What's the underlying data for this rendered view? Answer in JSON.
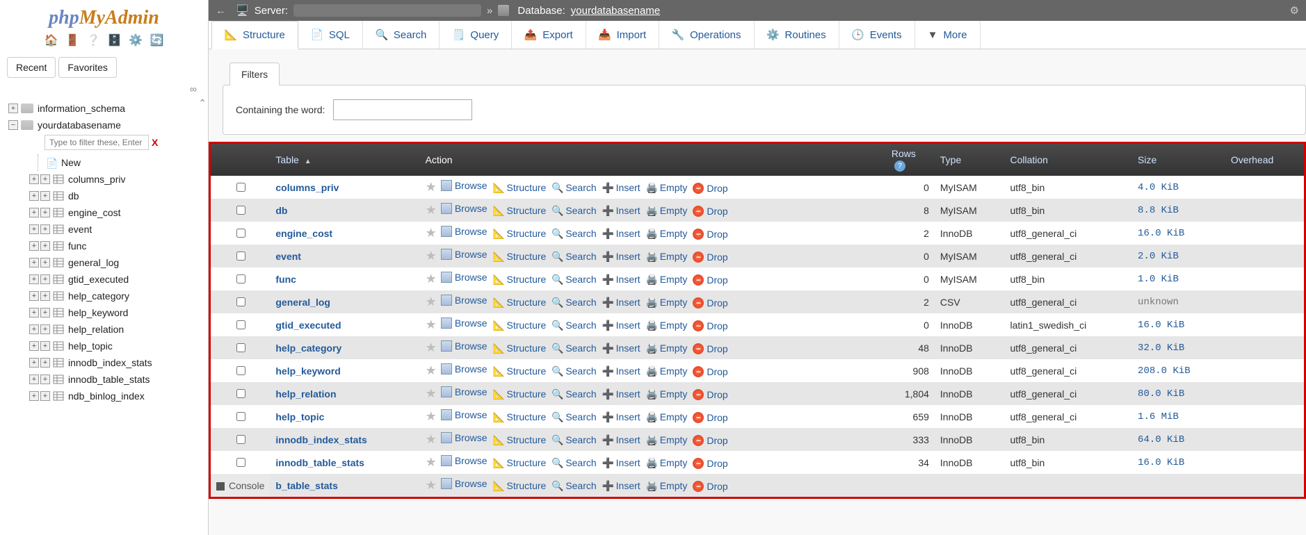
{
  "logo": {
    "part1": "php",
    "part2": "MyAdmin"
  },
  "sidebar_tabs": {
    "recent": "Recent",
    "favorites": "Favorites"
  },
  "link_symbol": "∞",
  "tree": {
    "db1": "information_schema",
    "db2": "yourdatabasename",
    "filter_placeholder": "Type to filter these, Enter to se",
    "new_label": "New",
    "tables": [
      "columns_priv",
      "db",
      "engine_cost",
      "event",
      "func",
      "general_log",
      "gtid_executed",
      "help_category",
      "help_keyword",
      "help_relation",
      "help_topic",
      "innodb_index_stats",
      "innodb_table_stats",
      "ndb_binlog_index"
    ]
  },
  "breadcrumb": {
    "server_label": "Server:",
    "database_label": "Database:",
    "database_name": "yourdatabasename"
  },
  "topmenu": [
    {
      "key": "structure",
      "label": "Structure"
    },
    {
      "key": "sql",
      "label": "SQL"
    },
    {
      "key": "search",
      "label": "Search"
    },
    {
      "key": "query",
      "label": "Query"
    },
    {
      "key": "export",
      "label": "Export"
    },
    {
      "key": "import",
      "label": "Import"
    },
    {
      "key": "operations",
      "label": "Operations"
    },
    {
      "key": "routines",
      "label": "Routines"
    },
    {
      "key": "events",
      "label": "Events"
    },
    {
      "key": "more",
      "label": "More"
    }
  ],
  "filters": {
    "title": "Filters",
    "containing_label": "Containing the word:"
  },
  "headers": {
    "table": "Table",
    "action": "Action",
    "rows": "Rows",
    "type": "Type",
    "collation": "Collation",
    "size": "Size",
    "overhead": "Overhead"
  },
  "actions": {
    "browse": "Browse",
    "structure": "Structure",
    "search": "Search",
    "insert": "Insert",
    "empty": "Empty",
    "drop": "Drop"
  },
  "rows": [
    {
      "name": "columns_priv",
      "rows": "0",
      "type": "MyISAM",
      "collation": "utf8_bin",
      "size": "4.0 KiB"
    },
    {
      "name": "db",
      "rows": "8",
      "type": "MyISAM",
      "collation": "utf8_bin",
      "size": "8.8 KiB"
    },
    {
      "name": "engine_cost",
      "rows": "2",
      "type": "InnoDB",
      "collation": "utf8_general_ci",
      "size": "16.0 KiB"
    },
    {
      "name": "event",
      "rows": "0",
      "type": "MyISAM",
      "collation": "utf8_general_ci",
      "size": "2.0 KiB"
    },
    {
      "name": "func",
      "rows": "0",
      "type": "MyISAM",
      "collation": "utf8_bin",
      "size": "1.0 KiB"
    },
    {
      "name": "general_log",
      "rows": "2",
      "type": "CSV",
      "collation": "utf8_general_ci",
      "size": "unknown"
    },
    {
      "name": "gtid_executed",
      "rows": "0",
      "type": "InnoDB",
      "collation": "latin1_swedish_ci",
      "size": "16.0 KiB"
    },
    {
      "name": "help_category",
      "rows": "48",
      "type": "InnoDB",
      "collation": "utf8_general_ci",
      "size": "32.0 KiB"
    },
    {
      "name": "help_keyword",
      "rows": "908",
      "type": "InnoDB",
      "collation": "utf8_general_ci",
      "size": "208.0 KiB"
    },
    {
      "name": "help_relation",
      "rows": "1,804",
      "type": "InnoDB",
      "collation": "utf8_general_ci",
      "size": "80.0 KiB"
    },
    {
      "name": "help_topic",
      "rows": "659",
      "type": "InnoDB",
      "collation": "utf8_general_ci",
      "size": "1.6 MiB"
    },
    {
      "name": "innodb_index_stats",
      "rows": "333",
      "type": "InnoDB",
      "collation": "utf8_bin",
      "size": "64.0 KiB"
    },
    {
      "name": "innodb_table_stats",
      "rows": "34",
      "type": "InnoDB",
      "collation": "utf8_bin",
      "size": "16.0 KiB"
    }
  ],
  "partial_row_name": "b_table_stats",
  "console_label": "Console"
}
